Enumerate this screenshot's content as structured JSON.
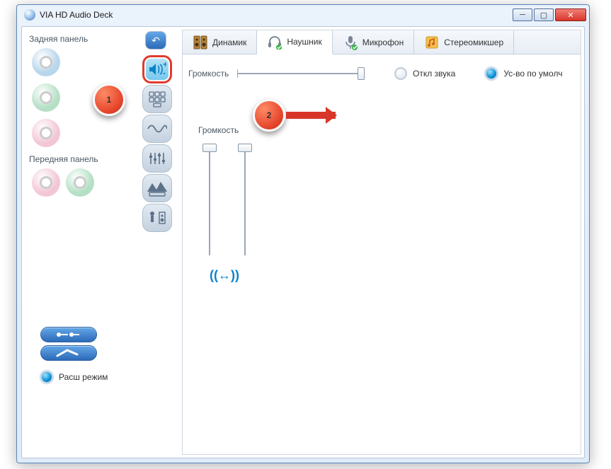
{
  "window": {
    "title": "VIA HD Audio Deck"
  },
  "left": {
    "rear_label": "Задняя панель",
    "front_label": "Передняя панель",
    "expand_label": "Расш режим"
  },
  "tabs": {
    "speaker": "Динамик",
    "headphone": "Наушник",
    "mic": "Микрофон",
    "stereomix": "Стереомикшер"
  },
  "panel": {
    "volume_label": "Громкость",
    "volume_label2": "Громкость",
    "mute_label": "Откл звука",
    "default_label": "Ус-во по умолч"
  },
  "callouts": {
    "one": "1",
    "two": "2"
  }
}
